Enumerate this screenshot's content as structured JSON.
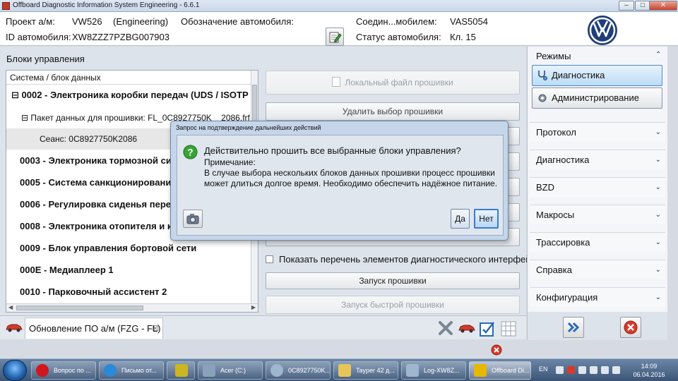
{
  "window": {
    "title": "Offboard Diagnostic Information System Engineering - 6.6.1",
    "minimize": "–",
    "maximize": "□",
    "close": "✕"
  },
  "header": {
    "project_label": "Проект а/м:",
    "project_value": "VW526",
    "project_mode": "(Engineering)",
    "vin_label": "ID автомобиля:",
    "vin_value": "XW8ZZZ7PZBG007903",
    "designation_label": "Обозначение автомобиля:",
    "connection_label": "Соедин...мобилем:",
    "connection_value": "VAS5054",
    "status_label": "Статус автомобиля:",
    "status_value": "Кл. 15"
  },
  "left": {
    "section_label": "Блоки управления",
    "list_header": "Система / блок данных",
    "rows": [
      {
        "text": "⊟ 0002 - Электроника коробки передач  (UDS / ISOTP",
        "bold": true
      },
      {
        "text": "⊟ Пакет данных для прошивки: FL_0C8927750K__2086.frf",
        "bold": false
      },
      {
        "text": "Сеанс: 0C8927750K2086",
        "bold": false
      },
      {
        "text": "0003 - Электроника тормозной сис",
        "bold": true
      },
      {
        "text": "0005 - Система санкционирования",
        "bold": true
      },
      {
        "text": "0006 - Регулировка сиденья перед",
        "bold": true
      },
      {
        "text": "0008 - Электроника отопителя и кл",
        "bold": true
      },
      {
        "text": "0009 - Блок управления бортовой сети",
        "bold": true
      },
      {
        "text": "000E - Медиаплеер 1",
        "bold": true
      },
      {
        "text": "0010 - Парковочный ассистент 2",
        "bold": true
      }
    ]
  },
  "buttons": {
    "local_file": "Локальный файл прошивки",
    "delete_selection": "Удалить выбор прошивки",
    "show_list": "Показать перечень элементов диагностического интерфейса",
    "start_flash": "Запуск прошивки",
    "start_fast_flash": "Запуск быстрой прошивки"
  },
  "tab": {
    "label": "Обновление ПО а/м (FZG - FL)",
    "close": "☒"
  },
  "sidebar": {
    "title": "Режимы",
    "modes": [
      {
        "label": "Диагностика",
        "active": true
      },
      {
        "label": "Администрирование",
        "active": false
      }
    ],
    "items": [
      "Протокол",
      "Диагностика",
      "BZD",
      "Макросы",
      "Трассировка",
      "Справка",
      "Конфигурация"
    ]
  },
  "dialog": {
    "title": "Запрос на подтверждение дальнейших действий",
    "line1": "Действительно прошить все выбранные блоки управления?",
    "line2": "Примечание:",
    "line3": "В случае выбора нескольких блоков данных прошивки процесс прошивки",
    "line4": "может длиться долгое время. Необходимо обеспечить надёжное питание.",
    "yes": "Да",
    "no": "Нет"
  },
  "taskbar": {
    "tasks": [
      {
        "label": "Вопрос по ...",
        "icon": "opera-icon",
        "color": "#d2161e"
      },
      {
        "label": "Письмо от...",
        "icon": "ie-icon",
        "color": "#2b8ad8"
      },
      {
        "label": "",
        "icon": "app-icon",
        "color": "#c9b620"
      },
      {
        "label": "Acer (C:)",
        "icon": "explorer-icon",
        "color": "#8aa1b9"
      },
      {
        "label": "0C8927750K...",
        "icon": "search-icon",
        "color": "#9fb6cf"
      },
      {
        "label": "Tayper 42 д...",
        "icon": "folder-icon",
        "color": "#e7c55a"
      },
      {
        "label": "Log-XW8Z...",
        "icon": "window-icon",
        "color": "#9fb6cf"
      },
      {
        "label": "Offboard Di...",
        "icon": "engine-icon",
        "color": "#e6b800"
      }
    ],
    "lang": "EN",
    "time": "14:09",
    "date": "06.04.2016"
  }
}
